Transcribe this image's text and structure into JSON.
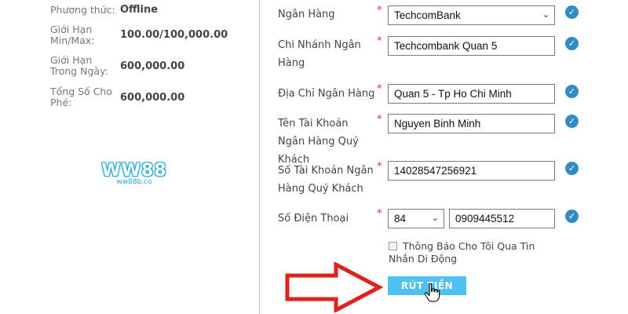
{
  "summary": {
    "method_label": "Phương thức:",
    "method_value": "Offline",
    "minmax_label": "Giới Hạn Min/Max:",
    "minmax_value": "100.00/100,000.00",
    "daily_label": "Giới Hạn Trong Ngày:",
    "daily_value": "600,000.00",
    "fee_label": "Tổng Số Cho Phé:",
    "fee_value": "600,000.00"
  },
  "logo": {
    "main": "WW88",
    "sub": "ww88b.co"
  },
  "form": {
    "required_mark": "*",
    "bank_label": "Ngân Hàng",
    "bank_value": "TechcomBank",
    "branch_label": "Chi Nhánh Ngân Hàng",
    "branch_value": "Techcombank Quan 5",
    "address_label": "Địa Chỉ Ngân Hàng",
    "address_value": "Quan 5 - Tp Ho Chi Minh",
    "holder_label": "Tên Tài Khoản Ngân Hàng Quý Khách",
    "holder_value": "Nguyen Binh Minh",
    "account_label": "Số Tài Khoản Ngân Hàng Quý Khách",
    "account_value": "14028547256921",
    "phone_label": "Số Điện Thoại",
    "phone_code": "84",
    "phone_value": "0909445512",
    "sms_label": "Thông Báo Cho Tôi Qua Tin Nhắn Di Động",
    "sms_checked": false,
    "submit_label": "RÚT TIỀN"
  },
  "colors": {
    "accent": "#4dc1f0",
    "check": "#2f8cc6",
    "arrow": "#e0221b"
  },
  "icons": [
    "check-circle-icon",
    "chevron-down-icon",
    "hand-cursor-icon",
    "arrow-right-icon"
  ]
}
